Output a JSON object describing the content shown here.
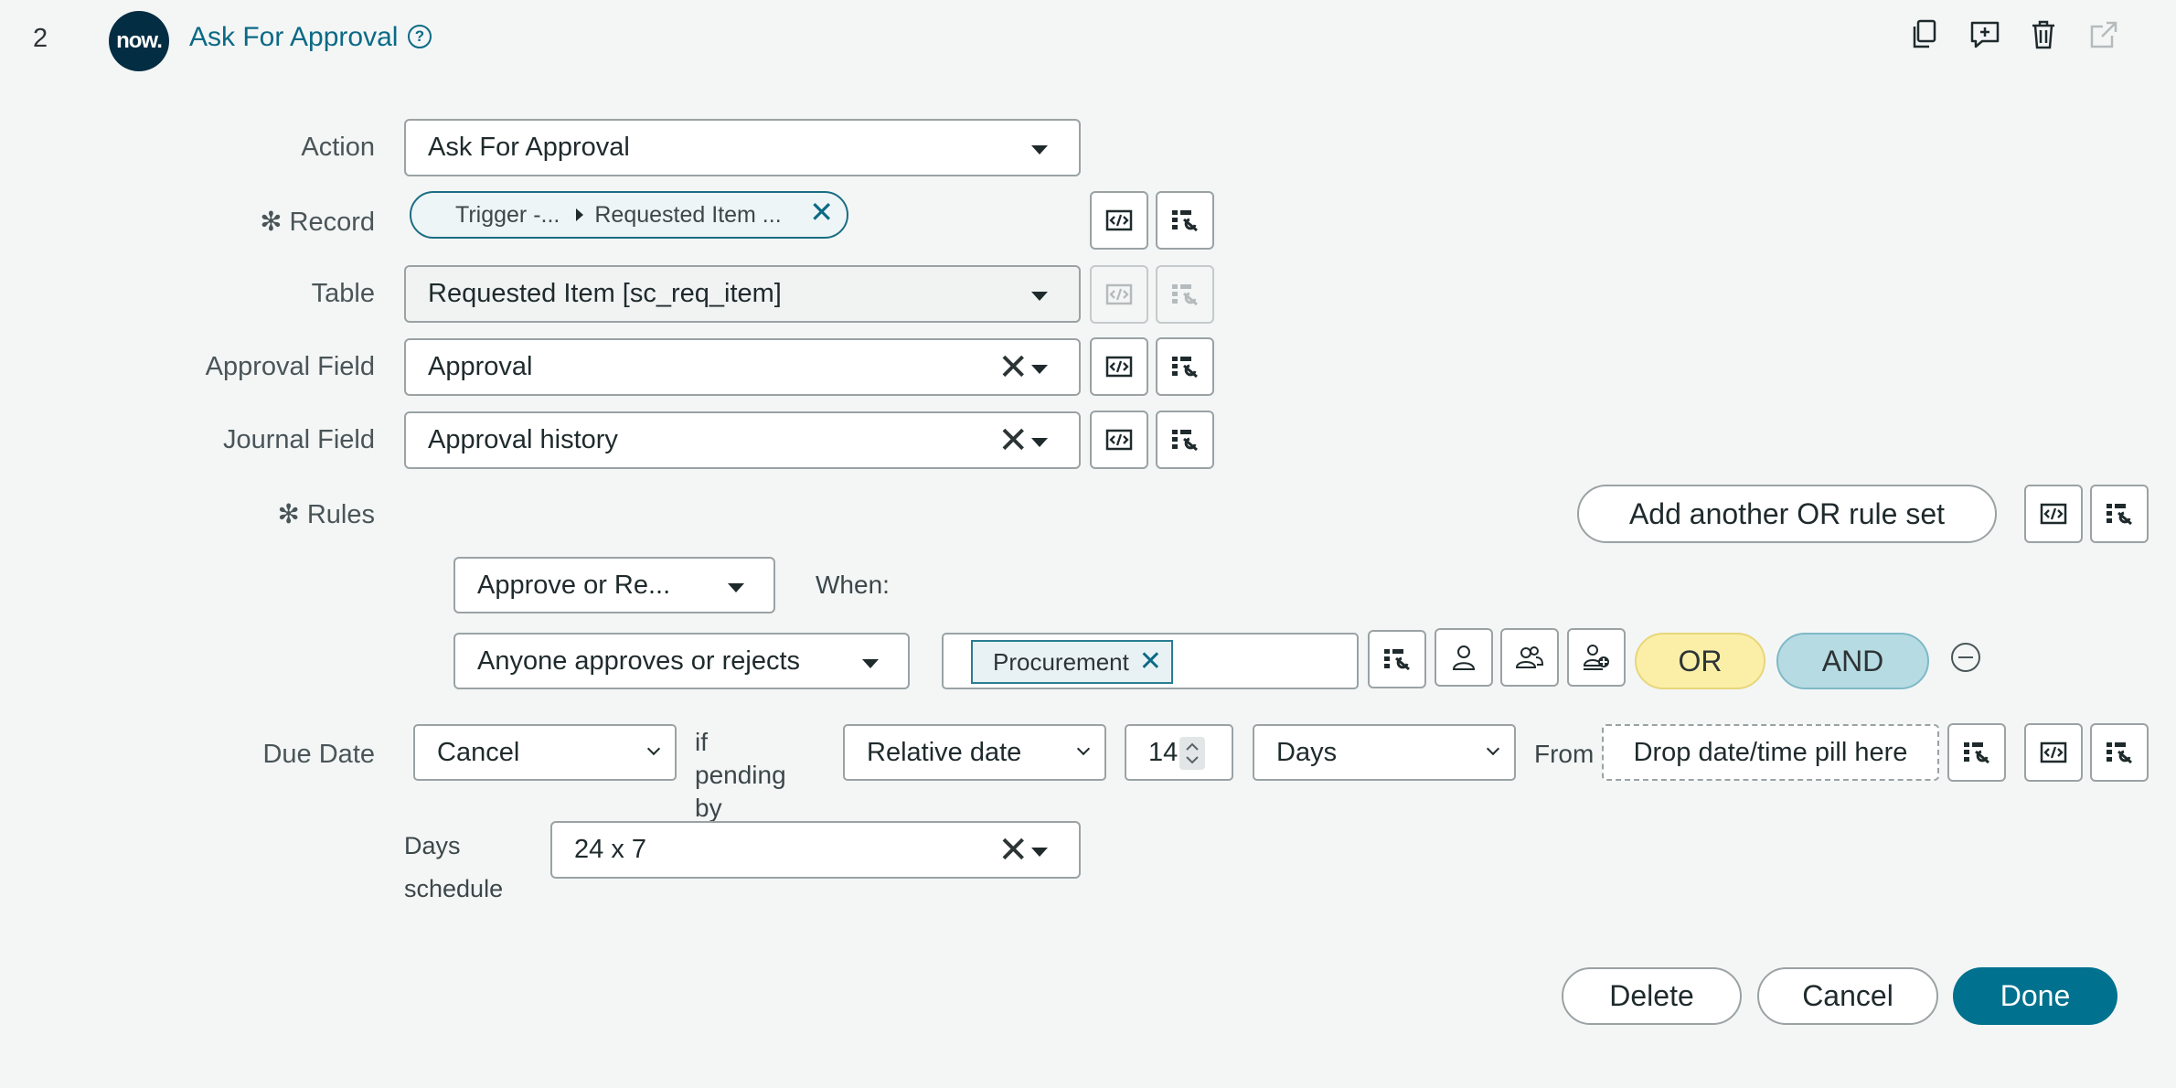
{
  "header": {
    "step_number": "2",
    "logo_text": "now.",
    "title": "Ask For Approval",
    "help_icon": "?"
  },
  "fields": {
    "action": {
      "label": "Action",
      "value": "Ask For Approval"
    },
    "record": {
      "label": "Record",
      "pill_part1": "Trigger -...",
      "pill_part2": "Requested Item ..."
    },
    "table": {
      "label": "Table",
      "value": "Requested Item [sc_req_item]"
    },
    "approval_field": {
      "label": "Approval Field",
      "value": "Approval"
    },
    "journal_field": {
      "label": "Journal Field",
      "value": "Approval history"
    }
  },
  "rules": {
    "label": "Rules",
    "add_or_label": "Add another OR rule set",
    "rule_type": "Approve or Re...",
    "when_label": "When:",
    "condition": "Anyone approves or rejects",
    "approver_pill": "Procurement",
    "or_label": "OR",
    "and_label": "AND"
  },
  "due_date": {
    "label": "Due Date",
    "action_value": "Cancel",
    "pending_by_label": "if pending by",
    "date_type": "Relative date",
    "amount": "14",
    "unit": "Days",
    "from_label": "From",
    "drop_placeholder": "Drop date/time pill here"
  },
  "schedule": {
    "label": "Days schedule",
    "value": "24 x 7"
  },
  "footer": {
    "delete_label": "Delete",
    "cancel_label": "Cancel",
    "done_label": "Done"
  },
  "colors": {
    "accent": "#0b6a85",
    "done_bg": "#00718e",
    "or_bg": "#fbefa8",
    "and_bg": "#b6dbe3",
    "logo_bg": "#032d42"
  }
}
